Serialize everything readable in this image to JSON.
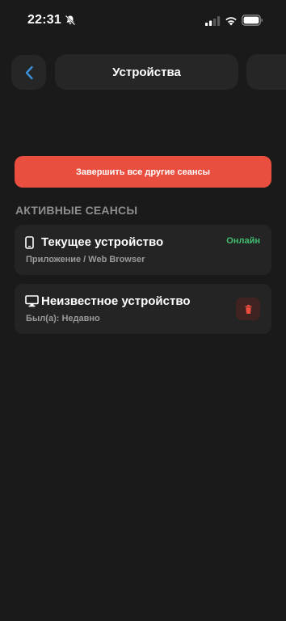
{
  "status_bar": {
    "time": "22:31"
  },
  "header": {
    "title": "Устройства"
  },
  "actions": {
    "terminate_all_label": "Завершить все другие сеансы"
  },
  "sessions": {
    "section_title": "АКТИВНЫЕ СЕАНСЫ",
    "items": [
      {
        "name": "Текущее устройство",
        "subtitle": "Приложение / Web Browser",
        "status": "Онлайн",
        "icon": "phone-icon"
      },
      {
        "name": "Неизвестное устройство",
        "subtitle": "Был(а): Недавно",
        "icon": "monitor-icon",
        "action_icon": "trash-icon"
      }
    ]
  },
  "colors": {
    "background": "#1a1a1a",
    "card": "#242424",
    "accent_red": "#e94e3f",
    "online_green": "#3fbf6f",
    "back_arrow_blue": "#3a8fd8"
  }
}
